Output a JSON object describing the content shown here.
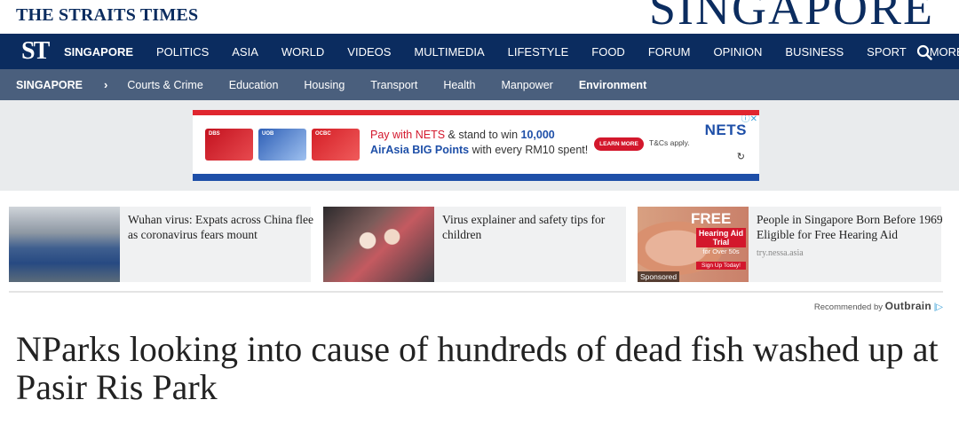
{
  "masthead": {
    "brand": "THE STRAITS TIMES",
    "edition": "SINGAPORE"
  },
  "main_nav": {
    "logo": "ST",
    "items": [
      {
        "label": "SINGAPORE",
        "active": true
      },
      {
        "label": "POLITICS"
      },
      {
        "label": "ASIA"
      },
      {
        "label": "WORLD"
      },
      {
        "label": "VIDEOS"
      },
      {
        "label": "MULTIMEDIA"
      },
      {
        "label": "LIFESTYLE"
      },
      {
        "label": "FOOD"
      },
      {
        "label": "FORUM"
      },
      {
        "label": "OPINION"
      },
      {
        "label": "BUSINESS"
      },
      {
        "label": "SPORT"
      },
      {
        "label": "MORE"
      }
    ],
    "search_icon": "search-icon",
    "colors": {
      "background": "#0b2c5f"
    }
  },
  "sub_nav": {
    "section": "SINGAPORE",
    "arrow": "›",
    "items": [
      {
        "label": "Courts & Crime"
      },
      {
        "label": "Education"
      },
      {
        "label": "Housing"
      },
      {
        "label": "Transport"
      },
      {
        "label": "Health"
      },
      {
        "label": "Manpower"
      },
      {
        "label": "Environment",
        "active": true
      }
    ],
    "colors": {
      "background": "#4a5f7d"
    }
  },
  "ad": {
    "line1_prefix": "Pay with NETS",
    "line1_middle": " & stand to win ",
    "line1_amount": "10,000",
    "line2_prefix": "AirAsia BIG Points",
    "line2_suffix": " with every RM10 spent!",
    "learn_more": "LEARN MORE",
    "tcs": "T&Cs apply.",
    "brand": "NETS",
    "card1": "DBS",
    "card2": "UOB",
    "card3": "OCBC",
    "close": "ⓘ✕",
    "replay": "↻",
    "colors": {
      "red": "#d3172c",
      "blue": "#1e4fa8"
    }
  },
  "recommended": [
    {
      "title": "Wuhan virus: Expats across China flee as coronavirus fears mount",
      "source": ""
    },
    {
      "title": "Virus explainer and safety tips for children",
      "source": ""
    },
    {
      "title": "People in Singapore Born Before 1969 Eligible for Free Hearing Aid",
      "source": "try.nessa.asia",
      "image_text": {
        "free": "FREE",
        "trial": "Hearing Aid Trial",
        "over": "for Over 50s",
        "signup": "Sign Up Today!",
        "sponsored": "Sponsored"
      }
    }
  ],
  "outbrain": {
    "label": "Recommended by",
    "brand": "Outbrain",
    "arrow": "|▷"
  },
  "article": {
    "headline": "NParks looking into cause of hundreds of dead fish washed up at Pasir Ris Park"
  }
}
